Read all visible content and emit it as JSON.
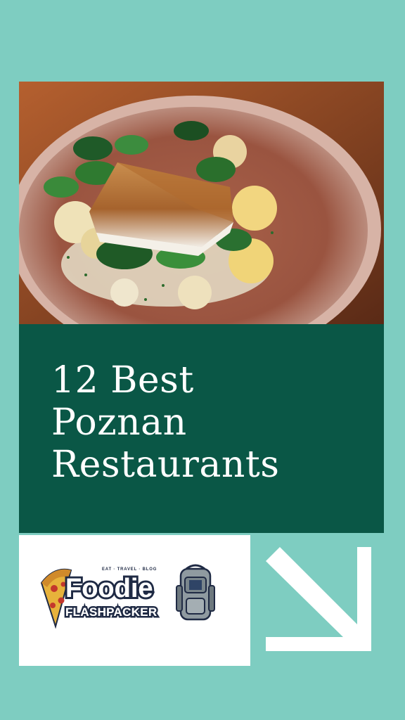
{
  "title": {
    "line1": "12 Best",
    "line2": "Poznan",
    "line3": "Restaurants"
  },
  "logo": {
    "tagline": "EAT · TRAVEL · BLOG",
    "word1": "Foodie",
    "word2": "FLASHPACKER"
  },
  "icons": {
    "arrow": "arrow-down-right-icon",
    "pizza": "pizza-slice-icon",
    "backpack": "backpack-icon"
  },
  "colors": {
    "background": "#7ecdc1",
    "panel": "#0a5746",
    "card": "#ffffff",
    "logo_dark": "#1f2a44"
  }
}
